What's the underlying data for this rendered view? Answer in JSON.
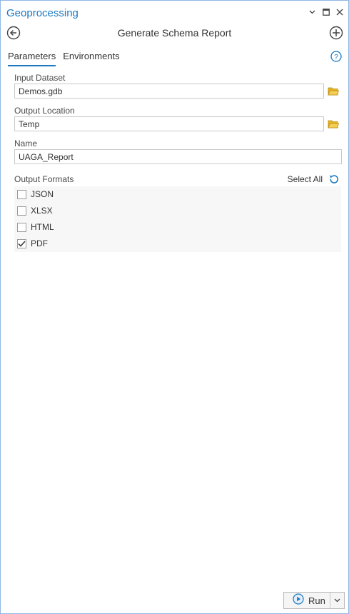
{
  "pane": {
    "title": "Geoprocessing",
    "tool_title": "Generate Schema Report"
  },
  "tabs": [
    {
      "label": "Parameters",
      "active": true
    },
    {
      "label": "Environments",
      "active": false
    }
  ],
  "params": {
    "input_dataset": {
      "label": "Input Dataset",
      "value": "Demos.gdb"
    },
    "output_location": {
      "label": "Output Location",
      "value": "Temp"
    },
    "name": {
      "label": "Name",
      "value": "UAGA_Report"
    },
    "output_formats": {
      "label": "Output Formats",
      "select_all_label": "Select All",
      "options": [
        {
          "label": "JSON",
          "checked": false
        },
        {
          "label": "XLSX",
          "checked": false
        },
        {
          "label": "HTML",
          "checked": false
        },
        {
          "label": "PDF",
          "checked": true
        }
      ]
    }
  },
  "footer": {
    "run_label": "Run"
  },
  "colors": {
    "accent": "#1b78c2",
    "folder": "#e6b422"
  }
}
